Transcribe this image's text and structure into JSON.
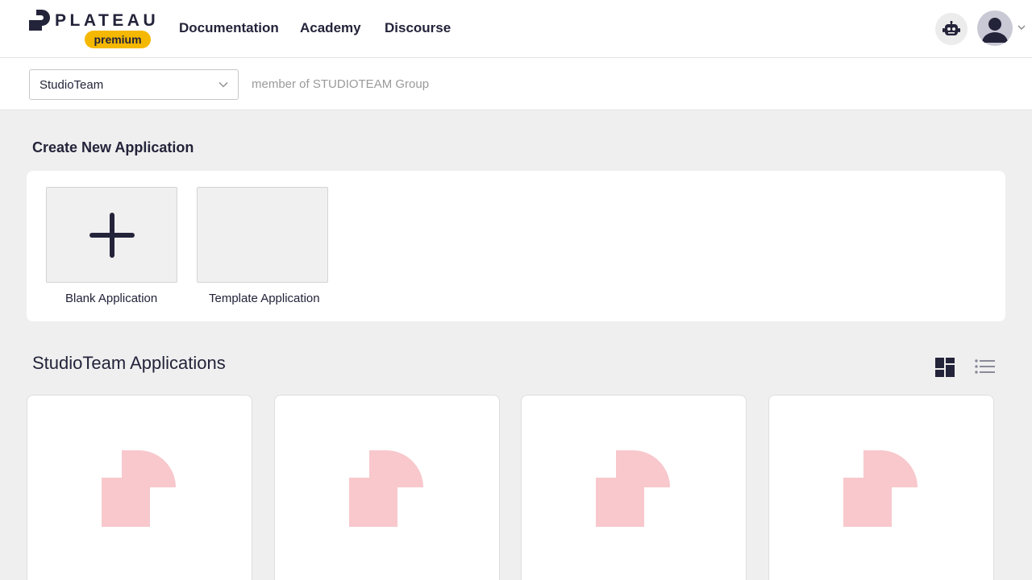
{
  "brand": {
    "wordmark": "PLATEAU",
    "badge": "premium",
    "badge_color": "#f5b800",
    "ink_color": "#23233a"
  },
  "nav": {
    "items": [
      "Documentation",
      "Academy",
      "Discourse"
    ]
  },
  "header_actions": {
    "assistant_icon": "robot-icon",
    "avatar_icon": "user-avatar-icon",
    "menu_icon": "chevron-down-icon"
  },
  "team_selector": {
    "value": "StudioTeam",
    "membership": "member of STUDIOTEAM Group"
  },
  "create_section": {
    "title": "Create New Application",
    "options": [
      {
        "label": "Blank Application",
        "icon": "plus-icon"
      },
      {
        "label": "Template Application",
        "icon": ""
      }
    ]
  },
  "apps_section": {
    "title": "StudioTeam Applications",
    "view_modes": [
      "grid-view-icon",
      "list-view-icon"
    ],
    "active_view": "grid",
    "card_placeholder_color": "#f8c8cc",
    "cards": [
      {
        "thumbnail": "plateau-logo-placeholder"
      },
      {
        "thumbnail": "plateau-logo-placeholder"
      },
      {
        "thumbnail": "plateau-logo-placeholder"
      },
      {
        "thumbnail": "plateau-logo-placeholder"
      }
    ]
  }
}
